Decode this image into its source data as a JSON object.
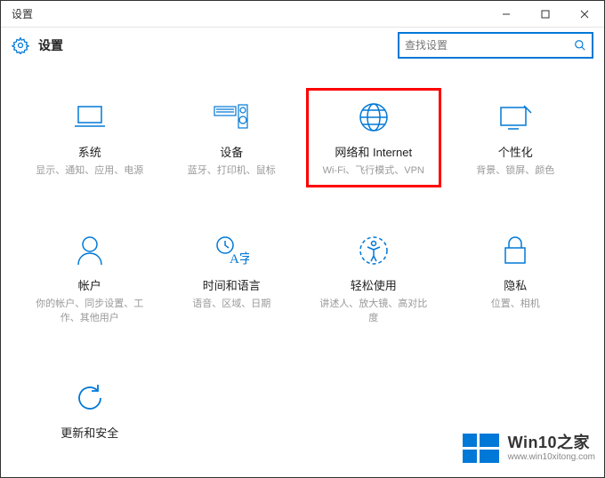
{
  "window": {
    "title": "设置"
  },
  "header": {
    "title": "设置"
  },
  "search": {
    "placeholder": "查找设置"
  },
  "tiles": {
    "system": {
      "title": "系统",
      "desc": "显示、通知、应用、电源"
    },
    "devices": {
      "title": "设备",
      "desc": "蓝牙、打印机、鼠标"
    },
    "network": {
      "title": "网络和 Internet",
      "desc": "Wi-Fi、飞行模式、VPN"
    },
    "personalization": {
      "title": "个性化",
      "desc": "背景、锁屏、颜色"
    },
    "accounts": {
      "title": "帐户",
      "desc": "你的帐户、同步设置、工作、其他用户"
    },
    "time": {
      "title": "时间和语言",
      "desc": "语音、区域、日期"
    },
    "ease": {
      "title": "轻松使用",
      "desc": "讲述人、放大镜、高对比度"
    },
    "privacy": {
      "title": "隐私",
      "desc": "位置、相机"
    },
    "update": {
      "title": "更新和安全",
      "desc": ""
    }
  },
  "watermark": {
    "brand": "Win10之家",
    "url": "www.win10xitong.com"
  }
}
